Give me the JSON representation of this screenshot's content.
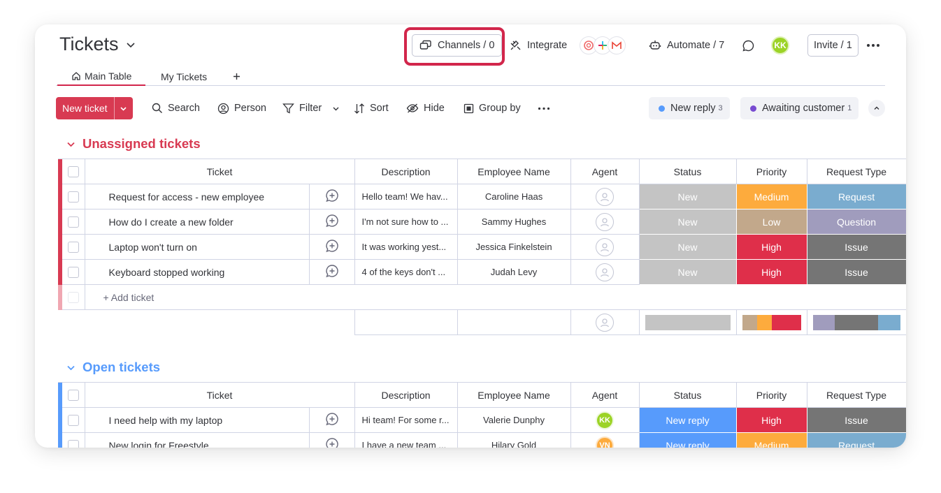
{
  "board": {
    "title": "Tickets"
  },
  "header": {
    "channels_label": "Channels / 0",
    "integrate_label": "Integrate",
    "automate_label": "Automate / 7",
    "user_initials": "KK",
    "invite_label": "Invite / 1"
  },
  "tabs": [
    {
      "label": "Main Table",
      "active": true
    },
    {
      "label": "My Tickets",
      "active": false
    }
  ],
  "toolbar": {
    "new_ticket": "New ticket",
    "search": "Search",
    "person": "Person",
    "filter": "Filter",
    "sort": "Sort",
    "hide": "Hide",
    "group_by": "Group by"
  },
  "status_pills": [
    {
      "label": "New reply",
      "count": "3",
      "color": "#579bfc"
    },
    {
      "label": "Awaiting customer",
      "count": "1",
      "color": "#784bd1"
    }
  ],
  "columns": {
    "ticket": "Ticket",
    "description": "Description",
    "employee": "Employee Name",
    "agent": "Agent",
    "status": "Status",
    "priority": "Priority",
    "request_type": "Request Type"
  },
  "colors": {
    "new": "#c4c4c4",
    "new_reply": "#579bfc",
    "medium": "#fdab3d",
    "low": "#c2a88b",
    "high": "#df2f4a",
    "request": "#7aaccf",
    "question": "#a09cbd",
    "issue": "#757575"
  },
  "groups": {
    "unassigned": {
      "title": "Unassigned tickets",
      "color": "#d83a52",
      "add_label": "+ Add ticket",
      "rows": [
        {
          "ticket": "Request for access - new employee",
          "description": "Hello team! We hav...",
          "employee": "Caroline Haas",
          "status": "New",
          "priority": "Medium",
          "request_type": "Request"
        },
        {
          "ticket": "How do I create a new folder",
          "description": "I'm not sure how to ...",
          "employee": "Sammy Hughes",
          "status": "New",
          "priority": "Low",
          "request_type": "Question"
        },
        {
          "ticket": "Laptop won't turn on",
          "description": "It was working yest...",
          "employee": "Jessica Finkelstein",
          "status": "New",
          "priority": "High",
          "request_type": "Issue"
        },
        {
          "ticket": "Keyboard stopped working",
          "description": "4 of the keys don't ...",
          "employee": "Judah Levy",
          "status": "New",
          "priority": "High",
          "request_type": "Issue"
        }
      ]
    },
    "open": {
      "title": "Open tickets",
      "color": "#579bfc",
      "rows": [
        {
          "ticket": "I need help with my laptop",
          "description": "Hi team! For some r...",
          "employee": "Valerie Dunphy",
          "agent": "KK",
          "status": "New reply",
          "priority": "High",
          "request_type": "Issue"
        },
        {
          "ticket": "New login for Freestyle",
          "description": "I have a new team ...",
          "employee": "Hilary Gold",
          "agent": "VN",
          "status": "New reply",
          "priority": "Medium",
          "request_type": "Request"
        }
      ]
    }
  }
}
